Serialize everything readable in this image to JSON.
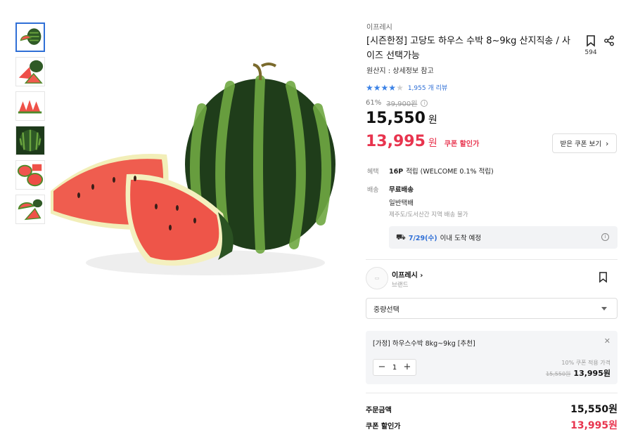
{
  "thumbnails": [
    {
      "name": "thumb-whole-watermelon",
      "active": true
    },
    {
      "name": "thumb-sliced-watermelon"
    },
    {
      "name": "thumb-watermelon-slices"
    },
    {
      "name": "thumb-whole-top"
    },
    {
      "name": "thumb-halves"
    },
    {
      "name": "thumb-cut-pieces"
    }
  ],
  "product": {
    "brand": "이프레시",
    "title": "[시즌한정] 고당도 하우스 수박 8~9kg 산지직송 / 사이즈 선택가능",
    "save_count": "594",
    "origin": "원산지 : 상세정보 참고",
    "rating": 4,
    "rating_max": 5,
    "review_text": "1,955 개 리뷰",
    "discount_rate": "61%",
    "original_price": "39,900원",
    "sale_price": "15,550",
    "coupon_price": "13,995",
    "won": "원",
    "coupon_label": "쿠폰 할인가",
    "coupon_button": "받은 쿠폰 보기"
  },
  "benefit": {
    "label": "혜택",
    "points": "16P",
    "text": "적립 (WELCOME 0.1% 적립)"
  },
  "delivery": {
    "label": "배송",
    "free": "무료배송",
    "type": "일반택배",
    "note": "제주도/도서산간 지역 배송 불가",
    "arrival_date": "7/29(수)",
    "arrival_text": "이내 도착 예정"
  },
  "seller": {
    "name": "이프레시",
    "arrow": "›",
    "sub": "브랜드"
  },
  "option_select": {
    "placeholder": "중량선택"
  },
  "selected_option": {
    "name": "[가정] 하우스수박 8kg~9kg [추천]",
    "quantity": "1",
    "coupon_label": "10% 쿠폰 적용 가격",
    "old_price": "15,550원",
    "new_price": "13,995원"
  },
  "summary": {
    "order_label": "주문금액",
    "order_value": "15,550원",
    "coupon_label": "쿠폰 할인가",
    "coupon_value": "13,995원"
  },
  "colors": {
    "accent_blue": "#2f6fd6",
    "price_red": "#e8344e"
  }
}
